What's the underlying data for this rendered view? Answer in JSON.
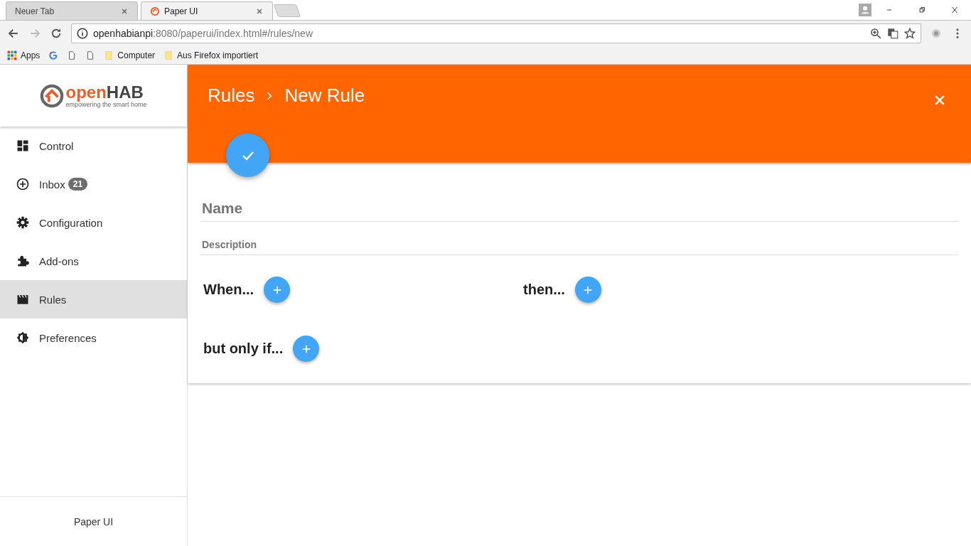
{
  "browser": {
    "tabs": [
      {
        "title": "Neuer Tab",
        "selected": false,
        "kind": "blank"
      },
      {
        "title": "Paper UI",
        "selected": true,
        "kind": "site"
      }
    ],
    "url": {
      "host": "openhabianpi",
      "path": ":8080/paperui/index.html#/rules/new"
    },
    "bookmarks": [
      {
        "kind": "apps",
        "label": "Apps"
      },
      {
        "kind": "google"
      },
      {
        "kind": "page"
      },
      {
        "kind": "page"
      },
      {
        "kind": "folder",
        "label": "Computer"
      },
      {
        "kind": "folder",
        "label": "Aus Firefox importiert"
      }
    ]
  },
  "logo": {
    "word_accent": "open",
    "word_rest": "HAB",
    "tagline": "empowering the smart home"
  },
  "sidebar": {
    "items": [
      {
        "label": "Control",
        "selected": false
      },
      {
        "label": "Inbox",
        "badge": "21",
        "selected": false
      },
      {
        "label": "Configuration",
        "selected": false
      },
      {
        "label": "Add-ons",
        "selected": false
      },
      {
        "label": "Rules",
        "selected": true
      },
      {
        "label": "Preferences",
        "selected": false
      }
    ],
    "footer": "Paper UI"
  },
  "header": {
    "breadcrumb": [
      "Rules",
      "New Rule"
    ]
  },
  "form": {
    "fields": [
      {
        "kind": "large",
        "placeholder": "Name"
      },
      {
        "kind": "small",
        "placeholder": "Description"
      }
    ],
    "sections": [
      {
        "title": "When..."
      },
      {
        "title": "then..."
      },
      {
        "title": "but only if..."
      }
    ]
  }
}
